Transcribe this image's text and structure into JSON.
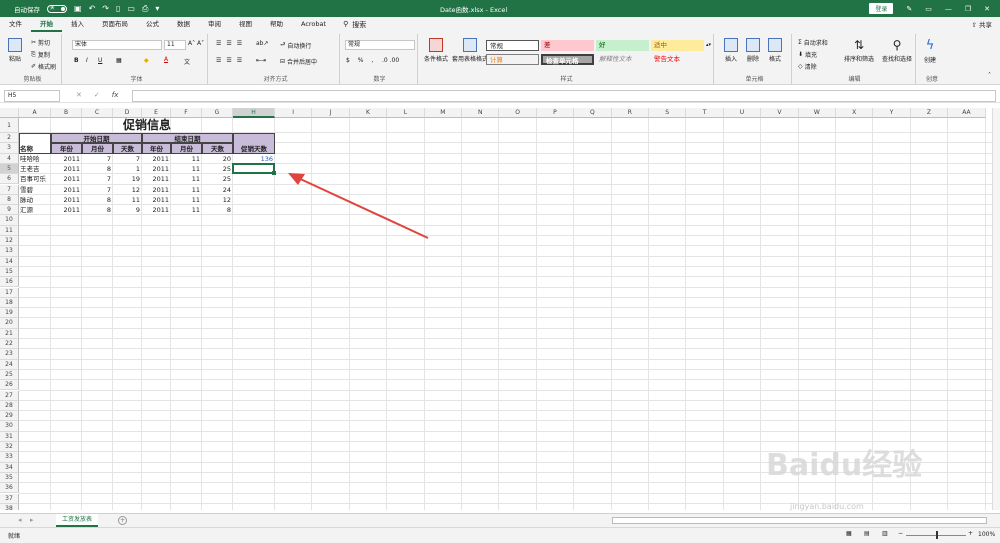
{
  "app": {
    "autosave_label": "自动保存",
    "autosave_state": "关",
    "window_title": "Date函数.xlsx - Excel",
    "login_label": "登录",
    "share_label": "共享"
  },
  "tabs": [
    "文件",
    "开始",
    "插入",
    "页面布局",
    "公式",
    "数据",
    "审阅",
    "视图",
    "帮助",
    "Acrobat"
  ],
  "search_label": "搜索",
  "ribbon": {
    "clipboard": {
      "paste": "粘贴",
      "cut": "剪切",
      "copy": "复制",
      "format_painter": "格式刷",
      "label": "剪贴板"
    },
    "font": {
      "font_name": "宋体",
      "font_size": "11",
      "bold": "B",
      "italic": "I",
      "underline": "U",
      "label": "字体"
    },
    "align": {
      "wrap": "自动换行",
      "merge": "合并后居中",
      "label": "对齐方式"
    },
    "number": {
      "format": "常规",
      "label": "数字"
    },
    "styles": {
      "conditional": "条件格式",
      "table": "套用表格格式",
      "normal": "常规",
      "bad": "差",
      "good": "好",
      "neutral": "适中",
      "calc": "计算",
      "check": "检查单元格",
      "explanatory": "解释性文本",
      "warning": "警告文本",
      "label": "样式"
    },
    "cells": {
      "insert": "插入",
      "delete": "删除",
      "format": "格式",
      "label": "单元格"
    },
    "editing": {
      "autosum": "自动求和",
      "fill": "填充",
      "clear": "清除",
      "sort": "排序和筛选",
      "find": "查找和选择",
      "label": "编辑"
    },
    "create": {
      "create": "创建",
      "label": "创意"
    }
  },
  "formula_bar": {
    "name_box": "H5",
    "fx": "fx",
    "value": ""
  },
  "columns": [
    "A",
    "B",
    "C",
    "D",
    "E",
    "F",
    "G",
    "H",
    "I",
    "J",
    "K",
    "L",
    "M",
    "N",
    "O",
    "P",
    "Q",
    "R",
    "S",
    "T",
    "U",
    "V",
    "W",
    "X",
    "Y",
    "Z",
    "AA"
  ],
  "rows": [
    "1",
    "2",
    "3",
    "4",
    "5",
    "6",
    "7",
    "8",
    "9",
    "10",
    "11",
    "12",
    "13",
    "14",
    "15",
    "16",
    "17",
    "18",
    "19",
    "20",
    "21",
    "22",
    "23",
    "24",
    "25",
    "26",
    "27",
    "28",
    "29",
    "30",
    "31",
    "32",
    "33",
    "34",
    "35",
    "36",
    "37",
    "38",
    "39"
  ],
  "sheet": {
    "title": "促销信息",
    "start_date_header": "开始日期",
    "end_date_header": "结束日期",
    "name_header": "名称",
    "year_header": "年份",
    "month_header": "月份",
    "day_header": "天数",
    "promo_days_header": "促销天数",
    "records": [
      {
        "name": "哇哈哈",
        "sy": "2011",
        "sm": "7",
        "sd": "7",
        "ey": "2011",
        "em": "11",
        "ed": "20",
        "days": "136"
      },
      {
        "name": "王老吉",
        "sy": "2011",
        "sm": "8",
        "sd": "1",
        "ey": "2011",
        "em": "11",
        "ed": "25",
        "days": ""
      },
      {
        "name": "百事可乐",
        "sy": "2011",
        "sm": "7",
        "sd": "19",
        "ey": "2011",
        "em": "11",
        "ed": "25",
        "days": ""
      },
      {
        "name": "雪碧",
        "sy": "2011",
        "sm": "7",
        "sd": "12",
        "ey": "2011",
        "em": "11",
        "ed": "24",
        "days": ""
      },
      {
        "name": "脉动",
        "sy": "2011",
        "sm": "8",
        "sd": "11",
        "ey": "2011",
        "em": "11",
        "ed": "12",
        "days": ""
      },
      {
        "name": "汇源",
        "sy": "2011",
        "sm": "8",
        "sd": "9",
        "ey": "2011",
        "em": "11",
        "ed": "8",
        "days": ""
      }
    ]
  },
  "sheet_tab": "工资发放表",
  "status": {
    "ready": "就绪",
    "zoom": "100%"
  },
  "watermark": {
    "logo": "Baidu经验",
    "url": "jingyan.baidu.com"
  },
  "colors": {
    "excel_green": "#217346",
    "header_fill": "#c8bcd9",
    "arrow": "#e0443e"
  }
}
